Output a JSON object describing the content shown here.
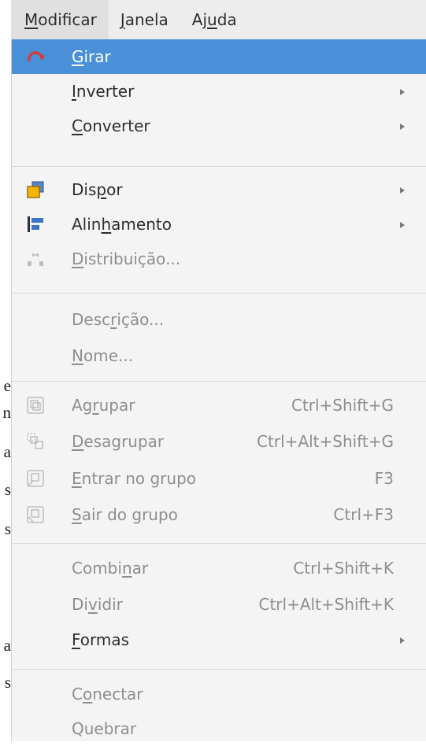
{
  "menubar": {
    "modificar": {
      "pre": "",
      "u": "M",
      "post": "odificar"
    },
    "janela": {
      "pre": "",
      "u": "J",
      "post": "anela"
    },
    "ajuda": {
      "pre": "Aj",
      "u": "u",
      "post": "da"
    }
  },
  "menu": {
    "girar": {
      "pre": "",
      "u": "G",
      "post": "irar"
    },
    "inverter": {
      "pre": "",
      "u": "I",
      "post": "nverter"
    },
    "converter": {
      "pre": "",
      "u": "C",
      "post": "onverter"
    },
    "dispor": {
      "pre": "Dis",
      "u": "p",
      "post": "or"
    },
    "alinhamento": {
      "pre": "Alin",
      "u": "h",
      "post": "amento"
    },
    "distribuicao": {
      "pre": "",
      "u": "D",
      "post": "istribuição..."
    },
    "descricao": {
      "pre": "Desc",
      "u": "r",
      "post": "ição..."
    },
    "nome": {
      "pre": "",
      "u": "N",
      "post": "ome..."
    },
    "agrupar": {
      "pre": "Ag",
      "u": "r",
      "post": "upar",
      "shortcut": "Ctrl+Shift+G"
    },
    "desagrupar": {
      "pre": "",
      "u": "D",
      "post": "esagrupar",
      "shortcut": "Ctrl+Alt+Shift+G"
    },
    "entrar_grupo": {
      "pre": "",
      "u": "E",
      "post": "ntrar no grupo",
      "shortcut": "F3"
    },
    "sair_grupo": {
      "pre": "",
      "u": "S",
      "post": "air do grupo",
      "shortcut": "Ctrl+F3"
    },
    "combinar": {
      "pre": "Combi",
      "u": "n",
      "post": "ar",
      "shortcut": "Ctrl+Shift+K"
    },
    "dividir": {
      "pre": "Di",
      "u": "v",
      "post": "idir",
      "shortcut": "Ctrl+Alt+Shift+K"
    },
    "formas": {
      "pre": "",
      "u": "F",
      "post": "ormas"
    },
    "conectar": {
      "pre": "C",
      "u": "o",
      "post": "nectar"
    },
    "quebrar": {
      "pre": "Quebrar",
      "u": "",
      "post": ""
    }
  },
  "background_text": [
    "e",
    "n",
    "a",
    "s",
    "s",
    "a",
    "s"
  ],
  "colors": {
    "selection": "#4a90d9",
    "menu_bg": "#f4f4f4",
    "disabled_text": "#8e8e8e"
  }
}
